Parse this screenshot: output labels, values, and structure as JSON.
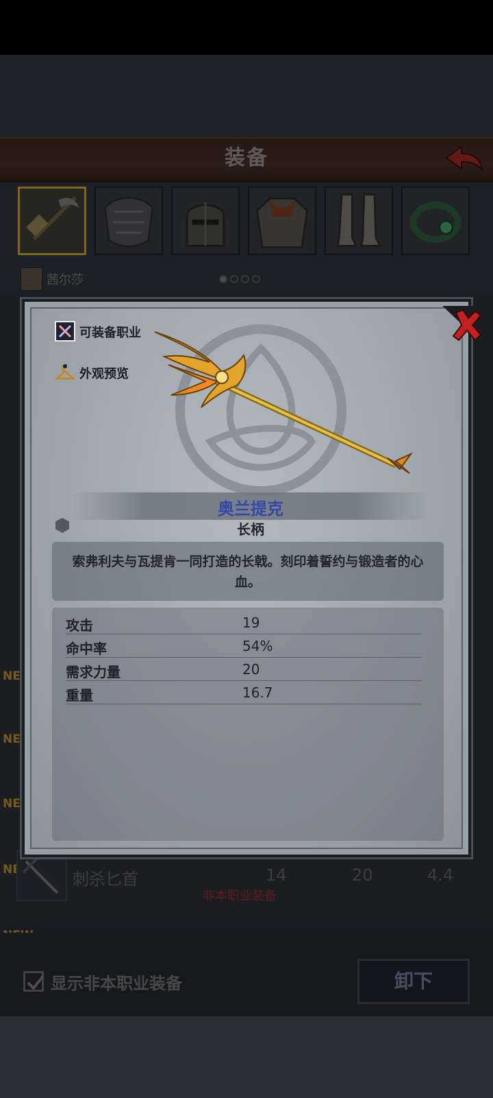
{
  "header": {
    "title": "装备"
  },
  "character": {
    "name": "茜尔莎"
  },
  "page_dots": {
    "count": 4,
    "active": 0
  },
  "list": {
    "new_badge": "NEW",
    "item": {
      "name": "刺杀匕首",
      "stat1": "14",
      "stat2": "20",
      "stat3": "4.4",
      "warning": "非本职业装备"
    }
  },
  "bottom": {
    "checkbox_label": "显示非本职业装备",
    "checked": true,
    "unequip_label": "卸下"
  },
  "modal": {
    "buttons": {
      "equip_class": "可装备职业",
      "appearance": "外观预览"
    },
    "item_name": "奥兰提克",
    "item_type": "长柄",
    "description": "索弗利夫与瓦提肯一同打造的长戟。刻印着誓约与锻造者的心血。",
    "stats": [
      {
        "label": "攻击",
        "value": "19"
      },
      {
        "label": "命中率",
        "value": "54%"
      },
      {
        "label": "需求力量",
        "value": "20"
      },
      {
        "label": "重量",
        "value": "16.7"
      }
    ]
  },
  "colors": {
    "accent_gold": "#c79b2e",
    "title_blue": "#3547a8",
    "close_red": "#c2221f",
    "warning_red": "#8a2c2c"
  }
}
